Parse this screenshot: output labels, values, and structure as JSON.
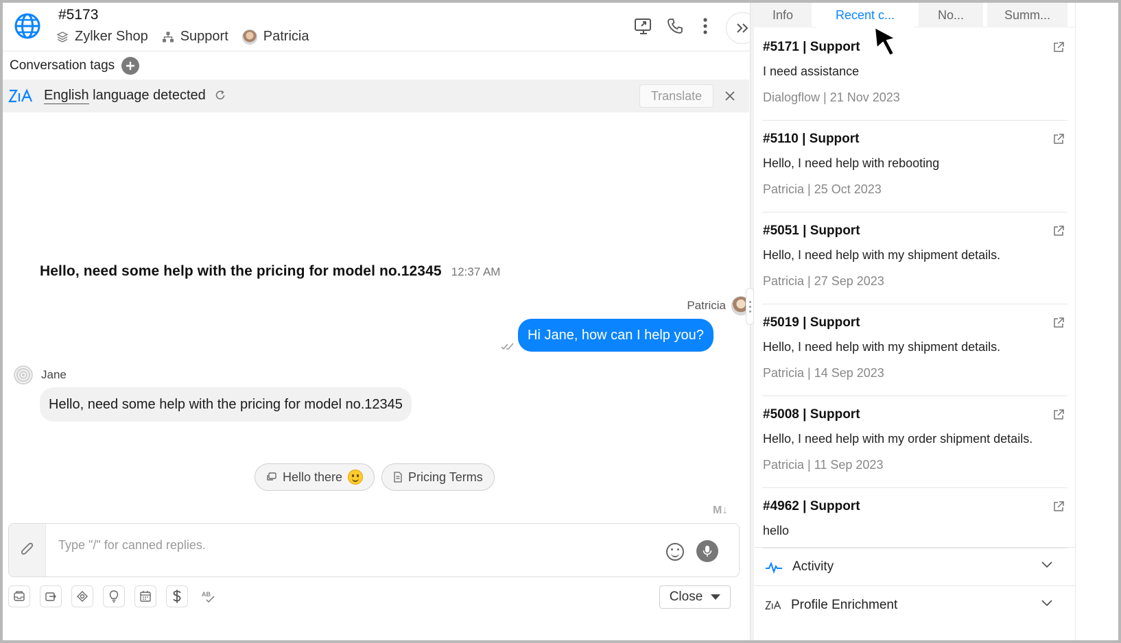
{
  "header": {
    "conversation_id": "#5173",
    "brand": "Zylker Shop",
    "department": "Support",
    "agent": "Patricia"
  },
  "tags": {
    "label": "Conversation tags"
  },
  "language_bar": {
    "language": "English",
    "message": "language detected",
    "translate_label": "Translate"
  },
  "messages": {
    "summary": {
      "text": "Hello, need some help with the pricing for model no.12345",
      "time": "12:37 AM"
    },
    "agent_name": "Patricia",
    "agent_message": "Hi Jane, how can I help you?",
    "visitor_name": "Jane",
    "visitor_message": "Hello, need some help with the pricing for model no.12345"
  },
  "suggestions": [
    {
      "label": "Hello there"
    },
    {
      "label": "Pricing Terms"
    }
  ],
  "composer": {
    "placeholder": "Type \"/\" for canned replies.",
    "markdown_badge": "M↓",
    "close_label": "Close"
  },
  "side": {
    "tabs": [
      {
        "label": "Info",
        "active": false
      },
      {
        "label": "Recent c...",
        "active": true
      },
      {
        "label": "No...",
        "active": false
      },
      {
        "label": "Summ...",
        "active": false
      }
    ],
    "recent": [
      {
        "title": "#5171 | Support",
        "message": "I need assistance",
        "meta": "Dialogflow | 21 Nov 2023"
      },
      {
        "title": "#5110 | Support",
        "message": "Hello, I need help with rebooting",
        "meta": "Patricia | 25 Oct 2023"
      },
      {
        "title": "#5051 | Support",
        "message": "Hello, I need help with my shipment details.",
        "meta": "Patricia | 27 Sep 2023"
      },
      {
        "title": "#5019 | Support",
        "message": "Hello, I need help with my shipment details.",
        "meta": "Patricia | 14 Sep 2023"
      },
      {
        "title": "#5008 | Support",
        "message": "Hello, I need help with my order shipment details.",
        "meta": "Patricia | 11 Sep 2023"
      },
      {
        "title": "#4962 | Support",
        "message": "hello",
        "meta": ""
      }
    ],
    "accordions": [
      {
        "label": "Activity"
      },
      {
        "label": "Profile Enrichment"
      }
    ]
  },
  "colors": {
    "accent": "#0a84ff",
    "bubble_in": "#f1f1f1",
    "lang_bar": "#f1f1f1"
  }
}
